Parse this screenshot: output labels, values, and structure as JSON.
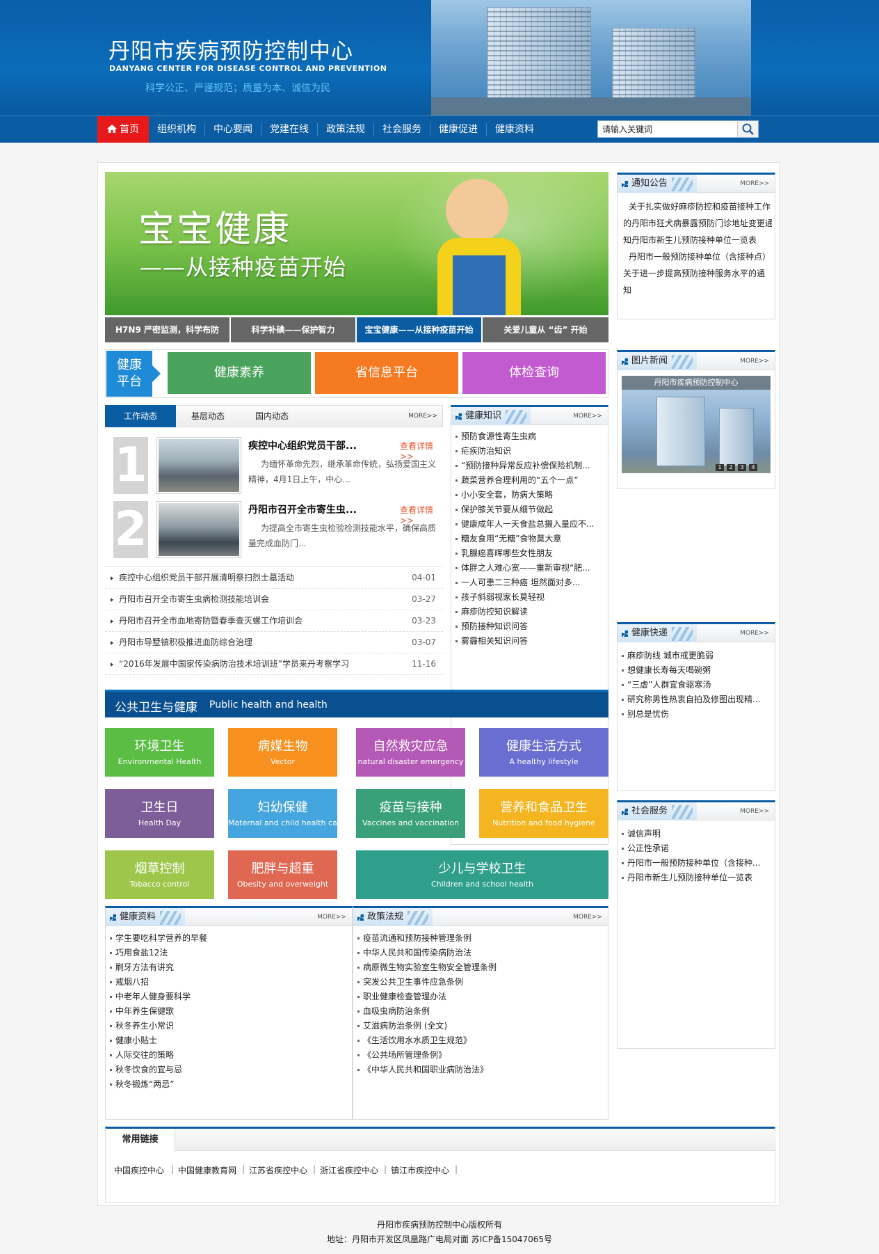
{
  "header": {
    "title": "丹阳市疾病预防控制中心",
    "title_en": "DANYANG CENTER FOR DISEASE CONTROL AND PREVENTION",
    "slogan": "科学公正、严谨规范；质量为本、诚信为民"
  },
  "nav": {
    "items": [
      "首页",
      "组织机构",
      "中心要闻",
      "党建在线",
      "政策法规",
      "社会服务",
      "健康促进",
      "健康资料"
    ],
    "active": "首页"
  },
  "search": {
    "value": "请输入关键词"
  },
  "banner": {
    "title": "宝宝健康",
    "subtitle": "——从接种疫苗开始",
    "tabs": [
      "H7N9 严密监测，科学布防",
      "科学补碘——保护智力",
      "宝宝健康——从接种疫苗开始",
      "关爱儿童从 “齿” 开始"
    ],
    "active_tab": "宝宝健康——从接种疫苗开始"
  },
  "platform": {
    "label_line1": "健康",
    "label_line2": "平台",
    "buttons": [
      "健康素养",
      "省信息平台",
      "体检查询"
    ],
    "colors": [
      "#4aa35c",
      "#f57a22",
      "#c25bd0"
    ]
  },
  "news": {
    "tabs": [
      "工作动态",
      "基层动态",
      "国内动态"
    ],
    "active_tab": "工作动态",
    "more": "MORE>>",
    "featured": [
      {
        "num": "1",
        "title": "疾控中心组织党员干部...",
        "detail": "查看详情>>",
        "summary_line1": "为缅怀革命先烈，继承革命传统，弘扬爱国主义",
        "summary_line2": "精神，4月1日上午，中心..."
      },
      {
        "num": "2",
        "title": "丹阳市召开全市寄生虫...",
        "detail": "查看详情>>",
        "summary_line1": "为提高全市寄生虫检验检测技能水平，确保高质",
        "summary_line2": "量完成血防门..."
      }
    ],
    "list": [
      {
        "title": "疾控中心组织党员干部开展清明祭扫烈士墓活动",
        "date": "04-01"
      },
      {
        "title": "丹阳市召开全市寄生虫病检测技能培训会",
        "date": "03-27"
      },
      {
        "title": "丹阳市召开全市血地寄防暨春季查灭螺工作培训会",
        "date": "03-23"
      },
      {
        "title": "丹阳市导墅镇积极推进血防综合治理",
        "date": "03-07"
      },
      {
        "title": "“2016年发展中国家传染病防治技术培训班”学员来丹考察学习",
        "date": "11-16"
      }
    ]
  },
  "knowledge": {
    "title": "健康知识",
    "more": "MORE>>",
    "items": [
      "预防食源性寄生虫病",
      "疟疾防治知识",
      "“预防接种异常反应补偿保险机制...",
      "蔬菜营养合理利用的“五个一点”",
      "小小安全套，防病大策略",
      "保护膝关节要从细节做起",
      "健康成年人一天食盐总摄入量应不...",
      "糖友食用“无糖”食物莫大意",
      "乳腺癌喜晖哪些女性朋友",
      "体胖之人难心宽——重新审视“肥...",
      "一人可患二三种癌 坦然面对多...",
      "孩子斜弱视家长莫轻视",
      "麻疹防控知识解读",
      "预防接种知识问答",
      "雾霾相关知识问答"
    ]
  },
  "notice": {
    "title": "通知公告",
    "more": "MORE>>",
    "lines": [
      "关于扎实做好麻疹防控和疫苗接种工作",
      "的丹阳市狂犬病暴露预防门诊地址变更通",
      "知丹阳市新生儿预防接种单位一览表",
      "丹阳市一般预防接种单位（含接种点）",
      "关于进一步提高预防接种服务水平的通",
      "知"
    ]
  },
  "photo_news": {
    "title": "图片新闻",
    "more": "MORE>>",
    "caption": "丹阳市疾病预防控制中心",
    "pager": [
      "1",
      "2",
      "3",
      "4"
    ]
  },
  "express": {
    "title": "健康快递",
    "more": "MORE>>",
    "items": [
      "麻疹防线 城市戒更脆弱",
      "想健康长寿每天喝碗粥",
      "“三虚”人群宜食驱寒汤",
      "研究称男性热衷自拍及修图出现精...",
      "别总是忧伤"
    ]
  },
  "social": {
    "title": "社会服务",
    "more": "MORE>>",
    "items": [
      "诚信声明",
      "公正性承诺",
      "丹阳市一般预防接种单位（含接种...",
      "丹阳市新生儿预防接种单位一览表"
    ]
  },
  "public_health": {
    "title_zh": "公共卫生与健康",
    "title_en": "Public health and health",
    "tiles": [
      {
        "zh": "环境卫生",
        "en": "Environmental Health",
        "color": "#5bbd44"
      },
      {
        "zh": "病媒生物",
        "en": "Vector",
        "color": "#f7901e"
      },
      {
        "zh": "自然救灾应急",
        "en": "natural disaster emergency",
        "color": "#b559b6"
      },
      {
        "zh": "健康生活方式",
        "en": "A healthy lifestyle",
        "color": "#6a6ed1"
      },
      {
        "zh": "卫生日",
        "en": "Health Day",
        "color": "#7d5e98"
      },
      {
        "zh": "妇幼保健",
        "en": "Maternal and child health care",
        "color": "#45a5df"
      },
      {
        "zh": "疫苗与接种",
        "en": "Vaccines and vaccination",
        "color": "#3aa079"
      },
      {
        "zh": "营养和食品卫生",
        "en": "Nutrition and food hygiene",
        "color": "#f4b520"
      },
      {
        "zh": "烟草控制",
        "en": "Tobacco control",
        "color": "#9dc64a"
      },
      {
        "zh": "肥胖与超重",
        "en": "Obesity and overweight",
        "color": "#e06752"
      },
      {
        "zh": "少儿与学校卫生",
        "en": "Children and school health",
        "color": "#2f9f8c"
      }
    ]
  },
  "materials": {
    "title": "健康资料",
    "more": "MORE>>",
    "items": [
      "学生要吃科学营养的早餐",
      "巧用食盐12法",
      "刷牙方法有讲究",
      "戒烟八招",
      "中老年人健身要科学",
      "中年养生保健歌",
      "秋冬养生小常识",
      "健康小贴士",
      "人际交往的策略",
      "秋冬饮食的宜与忌",
      "秋冬锻炼“两忌”"
    ]
  },
  "policy": {
    "title": "政策法规",
    "more": "MORE>>",
    "items": [
      "疫苗流通和预防接种管理条例",
      "中华人民共和国传染病防治法",
      "病原微生物实验室生物安全管理条例",
      "突发公共卫生事件应急条例",
      "职业健康检查管理办法",
      "血吸虫病防治条例",
      "艾滋病防治条例 (全文)",
      "《生活饮用水水质卫生规范》",
      "《公共场所管理条例》",
      "《中华人民共和国职业病防治法》"
    ]
  },
  "links": {
    "title": "常用链接",
    "items": [
      "中国疾控中心",
      "中国健康教育网",
      "江苏省疾控中心",
      "浙江省疾控中心",
      "镇江市疾控中心"
    ]
  },
  "footer": {
    "copyright": "丹阳市疾病预防控制中心版权所有",
    "address": "地址：丹阳市开发区凤凰路广电局对面 苏ICP备15047065号"
  }
}
